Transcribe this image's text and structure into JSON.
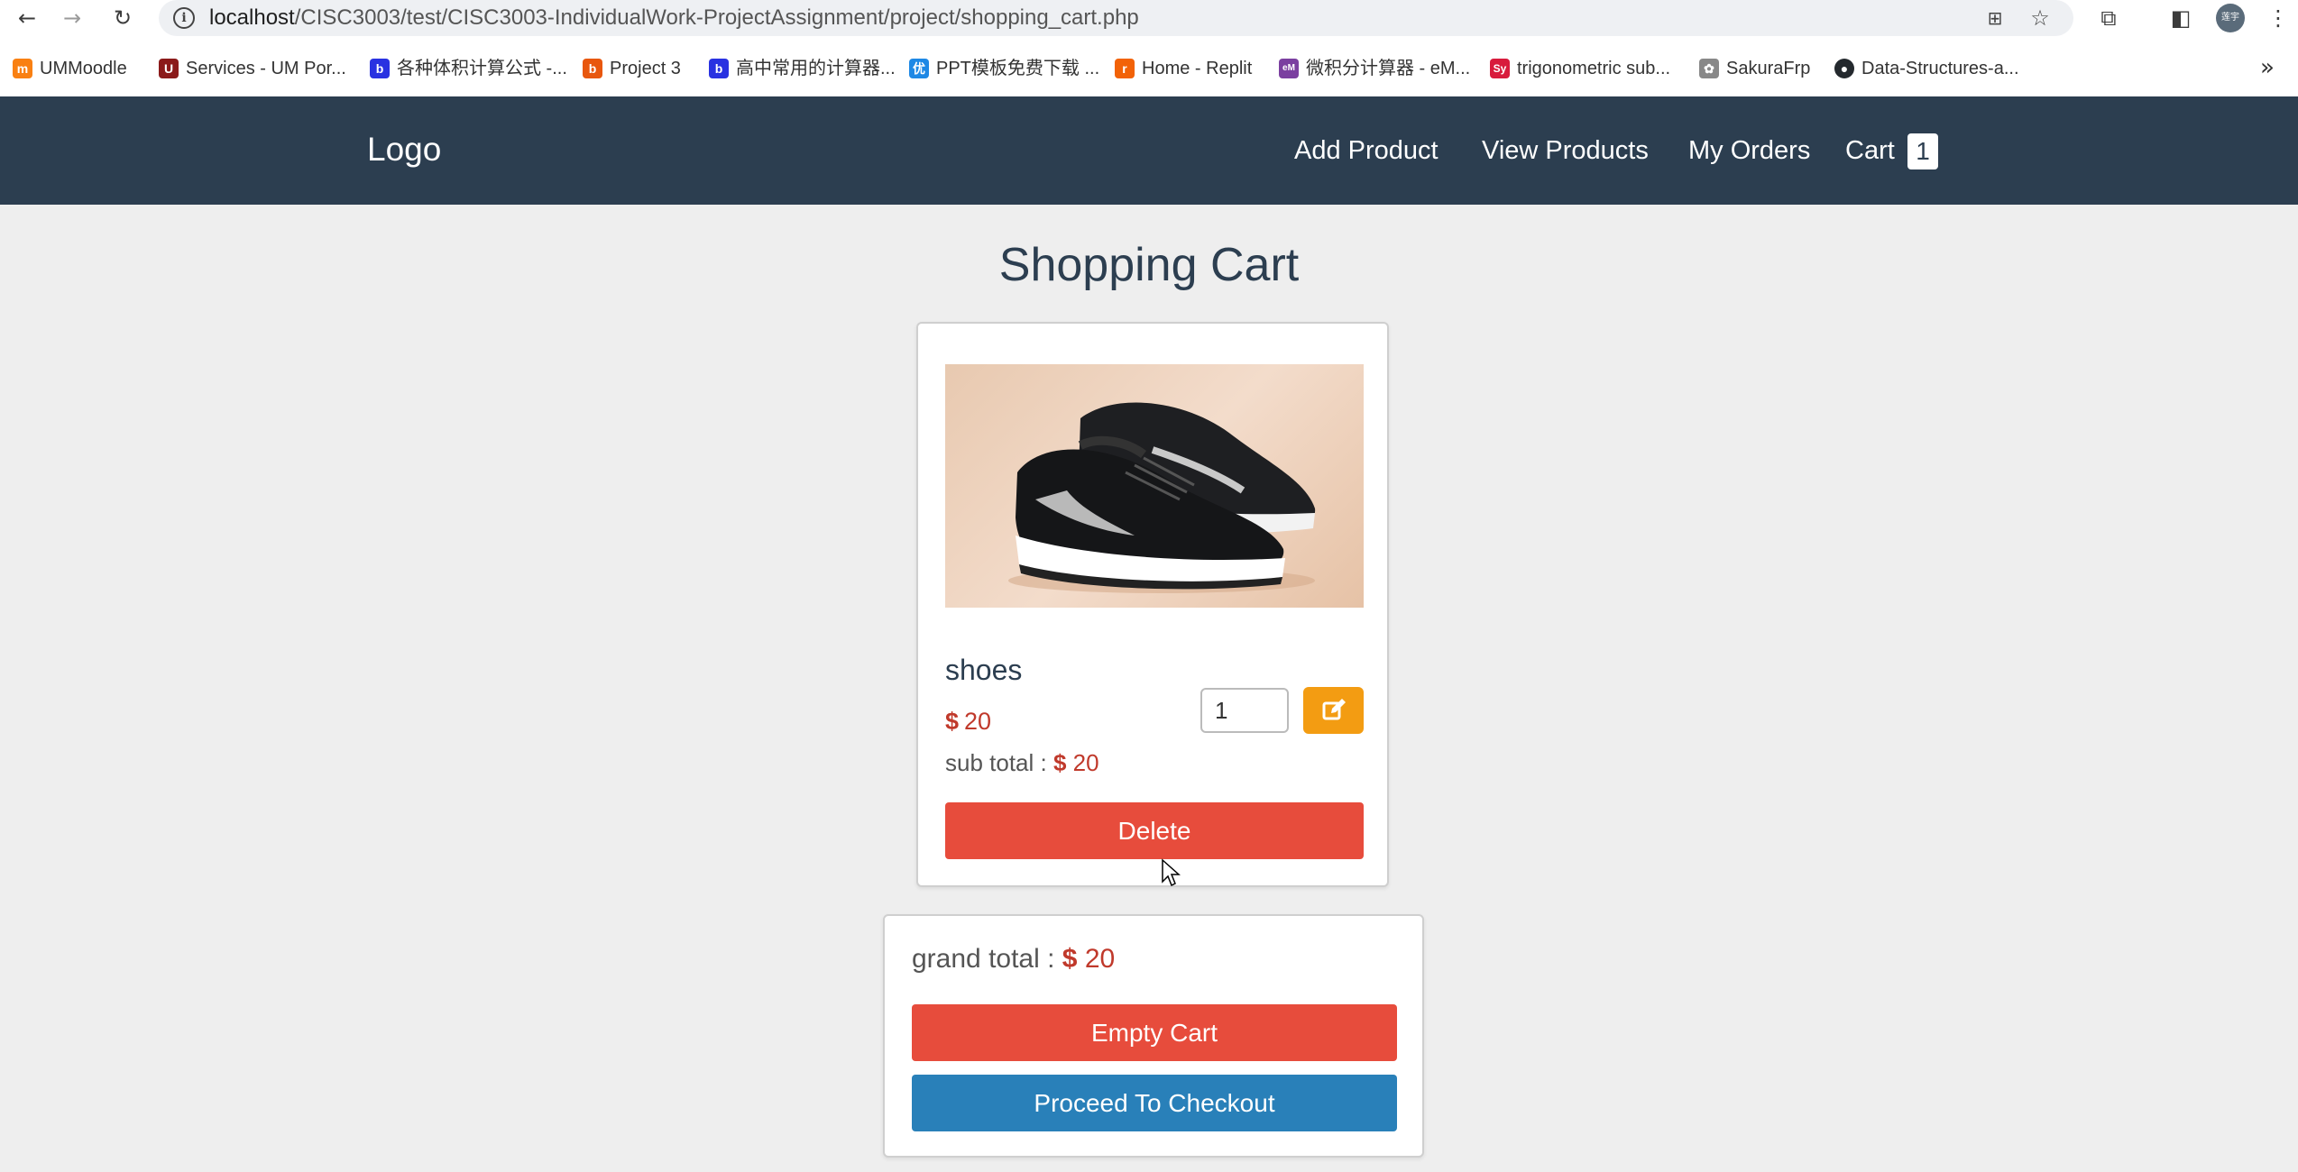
{
  "browser": {
    "url_host": "localhost",
    "url_path": "/CISC3003/test/CISC3003-IndividualWork-ProjectAssignment/project/shopping_cart.php",
    "bookmarks": [
      {
        "label": "UMMoodle",
        "icon": "moodle-icon",
        "color": "#f98012"
      },
      {
        "label": "Services - UM Por...",
        "icon": "um-icon",
        "color": "#8b1a1a"
      },
      {
        "label": "各种体积计算公式 -...",
        "icon": "baidu-icon",
        "color": "#2932e1"
      },
      {
        "label": "Project 3",
        "icon": "bell-icon",
        "color": "#e8570e"
      },
      {
        "label": "高中常用的计算器...",
        "icon": "baidu-icon",
        "color": "#2932e1"
      },
      {
        "label": "PPT模板免费下载 ...",
        "icon": "ppt-icon",
        "color": "#1e88e5"
      },
      {
        "label": "Home - Replit",
        "icon": "replit-icon",
        "color": "#f26207"
      },
      {
        "label": "微积分计算器 - eM...",
        "icon": "emath-icon",
        "color": "#7b3fa0"
      },
      {
        "label": "trigonometric sub...",
        "icon": "symbolab-icon",
        "color": "#d81b3c"
      },
      {
        "label": "SakuraFrp",
        "icon": "sakura-icon",
        "color": "#888888"
      },
      {
        "label": "Data-Structures-a...",
        "icon": "github-icon",
        "color": "#24292e"
      }
    ],
    "profile_label": "莲宇"
  },
  "header": {
    "logo": "Logo",
    "nav": {
      "add_product": "Add Product",
      "view_products": "View Products",
      "my_orders": "My Orders",
      "cart": "Cart",
      "cart_count": "1"
    }
  },
  "page": {
    "title": "Shopping Cart"
  },
  "cart_item": {
    "name": "shoes",
    "currency": "$",
    "price": "20",
    "quantity": "1",
    "subtotal_label": "sub total :",
    "subtotal_value": "20",
    "delete_label": "Delete"
  },
  "totals": {
    "grand_label": "grand total :",
    "currency": "$",
    "grand_value": "20",
    "empty_label": "Empty Cart",
    "checkout_label": "Proceed To Checkout"
  },
  "colors": {
    "header_bg": "#2c3e50",
    "danger": "#e74c3c",
    "warning": "#f39c12",
    "primary": "#2980b9",
    "price": "#c0392b"
  }
}
